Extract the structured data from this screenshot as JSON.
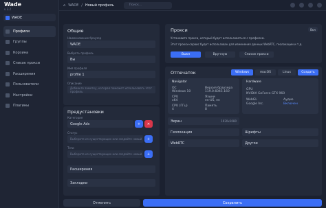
{
  "brand": {
    "title": "Wade",
    "subtitle": "v 3.2"
  },
  "profile_chip": "WADE",
  "nav": [
    "Профили",
    "Группы",
    "Корзина",
    "Список прокси",
    "Расширения",
    "Пользователи",
    "Настройки",
    "Плагины"
  ],
  "topbar": {
    "crumb_home": "WADE",
    "crumb_sep": "/",
    "crumb_page": "Новый профиль",
    "search_placeholder": "Поиск..."
  },
  "general": {
    "title": "Общие",
    "name_label": "Наименование браузер",
    "name_value": "WADE",
    "browser_label": "Выбрать профиль",
    "browser_value": "Вы",
    "profile_label": "Имя профиля",
    "profile_value": "profile 1",
    "notes_label": "Описание",
    "notes_placeholder": "Добавьте заметку, которая поможет использовать этот профиль"
  },
  "presets": {
    "title": "Предустановки",
    "cat_label": "Категория",
    "cat_value": "Google Ads",
    "status_label": "Статус",
    "status_placeholder": "Выберите из существующих или создайте новый",
    "tags_label": "Теги",
    "tags_placeholder": "Выберите из существующих или создайте новый",
    "ext": "Расширения",
    "bookmarks": "Закладки"
  },
  "proxy": {
    "title": "Прокси",
    "badge": "Вкл",
    "desc1": "Установите прокси, который будет использоваться с профилем.",
    "desc2": "Этот прокси-сервис будет использован для изменения данных WebRTC, геолокации и т.д.",
    "tabs": [
      "Выкл",
      "Вручную",
      "Список прокси"
    ]
  },
  "fingerprint": {
    "title": "Отпечаток",
    "os": [
      "Windows",
      "macOS",
      "Linux"
    ],
    "create": "Создать",
    "navigator": {
      "title": "Navigator",
      "k1": "ОС",
      "v1": "Windows 10",
      "k2": "Версия браузера",
      "v2": "119.0.6045.160",
      "k3": "CPU",
      "v3": "x64",
      "k4": "Языки",
      "v4": "en-US, en",
      "k5": "CPU (ГГц)",
      "v5": "4",
      "k6": "Память",
      "v6": "8"
    },
    "hardware": {
      "title": "Hardware",
      "k1": "GPU",
      "v1": "NVIDIA GeForce GTX 960",
      "k2": "WebGL",
      "v2": "Google Inc.",
      "k3": "Аудио",
      "v3": "Включен"
    },
    "screen": "Экран",
    "screen_val": "1920x1080",
    "fonts": "Шрифты",
    "geo": "Геолокация",
    "webrtc": "WebRTC",
    "other": "Другое"
  },
  "footer": {
    "cancel": "Отменить",
    "save": "Сохранить"
  }
}
